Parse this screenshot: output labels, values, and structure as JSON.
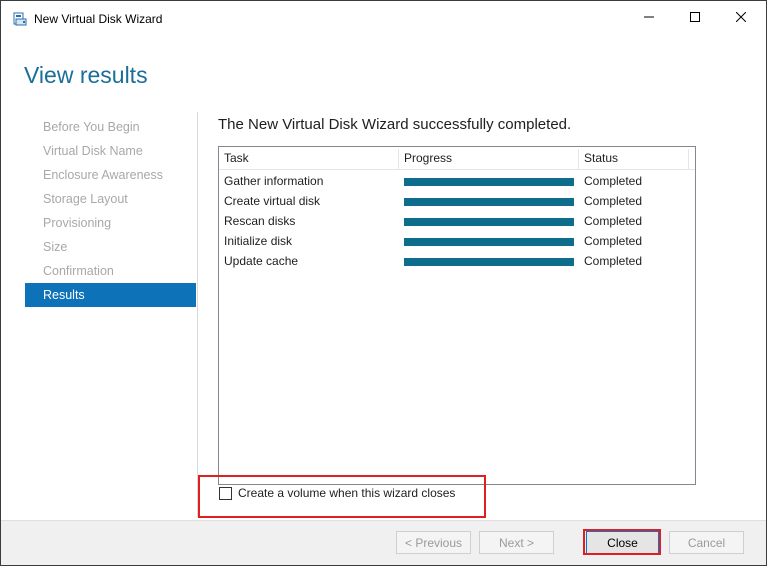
{
  "window": {
    "title": "New Virtual Disk Wizard",
    "icon": "virtual-disk-icon",
    "controls": {
      "minimize": "minimize-icon",
      "maximize": "maximize-icon",
      "close": "close-icon"
    }
  },
  "header": {
    "title": "View results"
  },
  "sidebar": {
    "items": [
      {
        "label": "Before You Begin",
        "active": false
      },
      {
        "label": "Virtual Disk Name",
        "active": false
      },
      {
        "label": "Enclosure Awareness",
        "active": false
      },
      {
        "label": "Storage Layout",
        "active": false
      },
      {
        "label": "Provisioning",
        "active": false
      },
      {
        "label": "Size",
        "active": false
      },
      {
        "label": "Confirmation",
        "active": false
      },
      {
        "label": "Results",
        "active": true
      }
    ]
  },
  "main": {
    "heading": "The New Virtual Disk Wizard successfully completed.",
    "table": {
      "columns": [
        "Task",
        "Progress",
        "Status"
      ],
      "rows": [
        {
          "task": "Gather information",
          "progress": 100,
          "status": "Completed"
        },
        {
          "task": "Create virtual disk",
          "progress": 100,
          "status": "Completed"
        },
        {
          "task": "Rescan disks",
          "progress": 100,
          "status": "Completed"
        },
        {
          "task": "Initialize disk",
          "progress": 100,
          "status": "Completed"
        },
        {
          "task": "Update cache",
          "progress": 100,
          "status": "Completed"
        }
      ]
    },
    "checkbox": {
      "label": "Create a volume when this wizard closes",
      "checked": false
    }
  },
  "footer": {
    "previous_label": "< Previous",
    "next_label": "Next >",
    "close_label": "Close",
    "cancel_label": "Cancel"
  },
  "colors": {
    "accent": "#0e72b8",
    "title": "#1a6e99",
    "progress": "#0e6d8a",
    "highlight": "#e02020"
  }
}
